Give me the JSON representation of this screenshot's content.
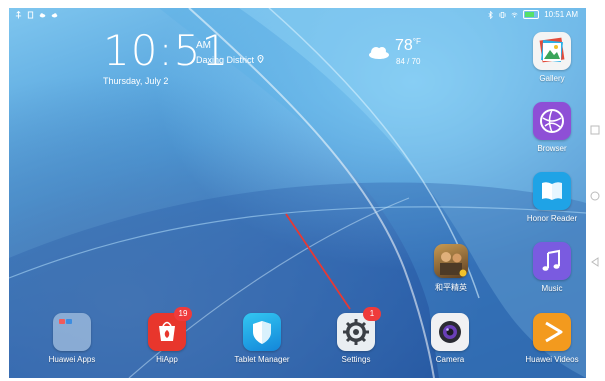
{
  "status_bar": {
    "time": "10:51 AM",
    "left_icons": [
      "usb-icon",
      "sim-icon",
      "cloud-icon",
      "cloud-upload-icon"
    ],
    "right_icons": [
      "bluetooth-icon",
      "vibrate-icon",
      "wifi-icon",
      "battery-icon"
    ]
  },
  "clock": {
    "time": "10:51",
    "ampm": "AM",
    "location": "Daxing District",
    "date": "Thursday, July 2"
  },
  "weather": {
    "temperature": "78",
    "unit": "°F",
    "range": "84 / 70"
  },
  "apps_right": [
    {
      "label": "Gallery",
      "icon": "gallery-icon"
    },
    {
      "label": "Browser",
      "icon": "browser-icon"
    },
    {
      "label": "Honor Reader",
      "icon": "book-icon"
    },
    {
      "label": "Music",
      "icon": "music-icon"
    }
  ],
  "game_app": {
    "label": "和平精英",
    "icon": "game-icon"
  },
  "dock": [
    {
      "label": "Huawei Apps",
      "icon": "folder-icon",
      "badge": ""
    },
    {
      "label": "HiApp",
      "icon": "hiapp-icon",
      "badge": "19"
    },
    {
      "label": "Tablet Manager",
      "icon": "shield-icon",
      "badge": ""
    },
    {
      "label": "Settings",
      "icon": "gear-icon",
      "badge": "1"
    },
    {
      "label": "Camera",
      "icon": "camera-icon",
      "badge": ""
    },
    {
      "label": "Huawei Videos",
      "icon": "play-icon",
      "badge": ""
    }
  ],
  "colors": {
    "accent_red": "#e53935",
    "badge_red": "#ef3b3b",
    "browser_purple": "#8e4fd6",
    "reader_blue": "#1fa3e6",
    "music_purple": "#7a5be0",
    "videos_orange": "#f39a1e",
    "hiapp_red": "#e8362c"
  }
}
